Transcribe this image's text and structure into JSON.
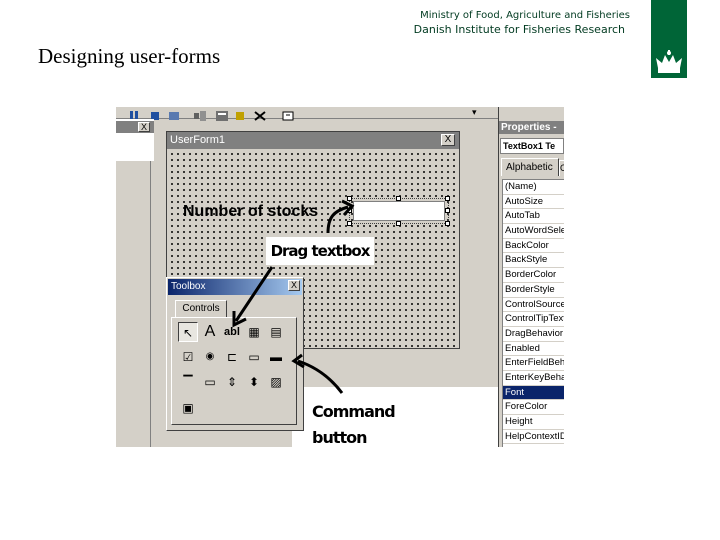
{
  "header": {
    "ministry": "Ministry of Food, Agriculture and Fisheries",
    "institute": "Danish Institute for Fisheries Research",
    "logo_icon": "crown-icon",
    "brand_color": "#006537"
  },
  "slide": {
    "title": "Designing user-forms"
  },
  "userform": {
    "title": "UserForm1",
    "close_glyph": "X",
    "label_text": "Number of stocks"
  },
  "annotations": {
    "drag_textbox": "Drag textbox",
    "command_button": "Command button"
  },
  "toolbox": {
    "title": "Toolbox",
    "close_glyph": "X",
    "tab_label": "Controls",
    "tools": [
      {
        "icon": "pointer-icon",
        "glyph": "↖"
      },
      {
        "icon": "label-icon",
        "glyph": "A"
      },
      {
        "icon": "textbox-icon",
        "glyph": "abl"
      },
      {
        "icon": "frame-icon",
        "glyph": "▦"
      },
      {
        "icon": "listbox-icon",
        "glyph": "▤"
      },
      {
        "icon": "checkbox-icon",
        "glyph": "☑"
      },
      {
        "icon": "optionbutton-icon",
        "glyph": "◉"
      },
      {
        "icon": "togglebutton-icon",
        "glyph": "⊏"
      },
      {
        "icon": "combobox-icon",
        "glyph": "▭"
      },
      {
        "icon": "commandbutton-icon",
        "glyph": "▬"
      },
      {
        "icon": "tabstrip-icon",
        "glyph": "▔"
      },
      {
        "icon": "multipage-icon",
        "glyph": "▭"
      },
      {
        "icon": "scrollbar-icon",
        "glyph": "⇕"
      },
      {
        "icon": "spinbutton-icon",
        "glyph": "⬍"
      },
      {
        "icon": "image-icon",
        "glyph": "▨"
      },
      {
        "icon": "refedit-icon",
        "glyph": "▣"
      }
    ]
  },
  "properties": {
    "title": "Properties - ",
    "selected_object": "TextBox1 Te",
    "tab_alphabetic": "Alphabetic",
    "tab_categorized": "C",
    "rows": [
      "(Name)",
      "AutoSize",
      "AutoTab",
      "AutoWordSelect",
      "BackColor",
      "BackStyle",
      "BorderColor",
      "BorderStyle",
      "ControlSource",
      "ControlTipText",
      "DragBehavior",
      "Enabled",
      "EnterFieldBehavior",
      "EnterKeyBehavior",
      "Font",
      "ForeColor",
      "Height",
      "HelpContextID"
    ],
    "selected_row": "Font"
  },
  "vbe": {
    "topbar_close_glyph": "X",
    "dropdown_glyph": "▾"
  }
}
